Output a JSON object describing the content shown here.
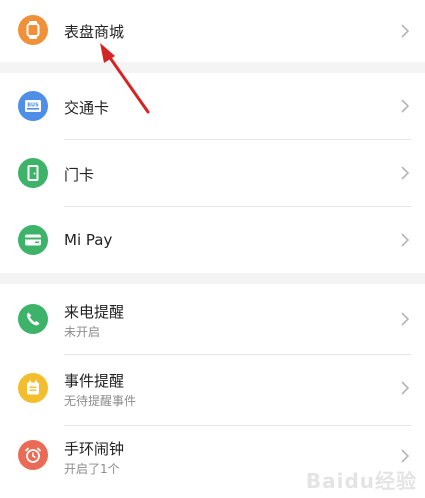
{
  "groups": [
    {
      "items": [
        {
          "title": "表盘商城",
          "icon": "watch-icon",
          "color": "#f0913a"
        }
      ]
    },
    {
      "items": [
        {
          "title": "交通卡",
          "icon": "bus-card-icon",
          "color": "#4d8fe6"
        },
        {
          "title": "门卡",
          "icon": "door-card-icon",
          "color": "#3db36a"
        },
        {
          "title": "Mi Pay",
          "icon": "wallet-icon",
          "color": "#3db36a"
        }
      ]
    },
    {
      "items": [
        {
          "title": "来电提醒",
          "subtitle": "未开启",
          "icon": "phone-icon",
          "color": "#3db36a"
        },
        {
          "title": "事件提醒",
          "subtitle": "无待提醒事件",
          "icon": "calendar-icon",
          "color": "#f3be2e"
        },
        {
          "title": "手环闹钟",
          "subtitle": "开启了1个",
          "icon": "alarm-clock-icon",
          "color": "#ea6b55"
        }
      ]
    }
  ],
  "bus_icon_text": "BUS",
  "watermark": "Baidu经验",
  "accent_arrow_color": "#d62424"
}
